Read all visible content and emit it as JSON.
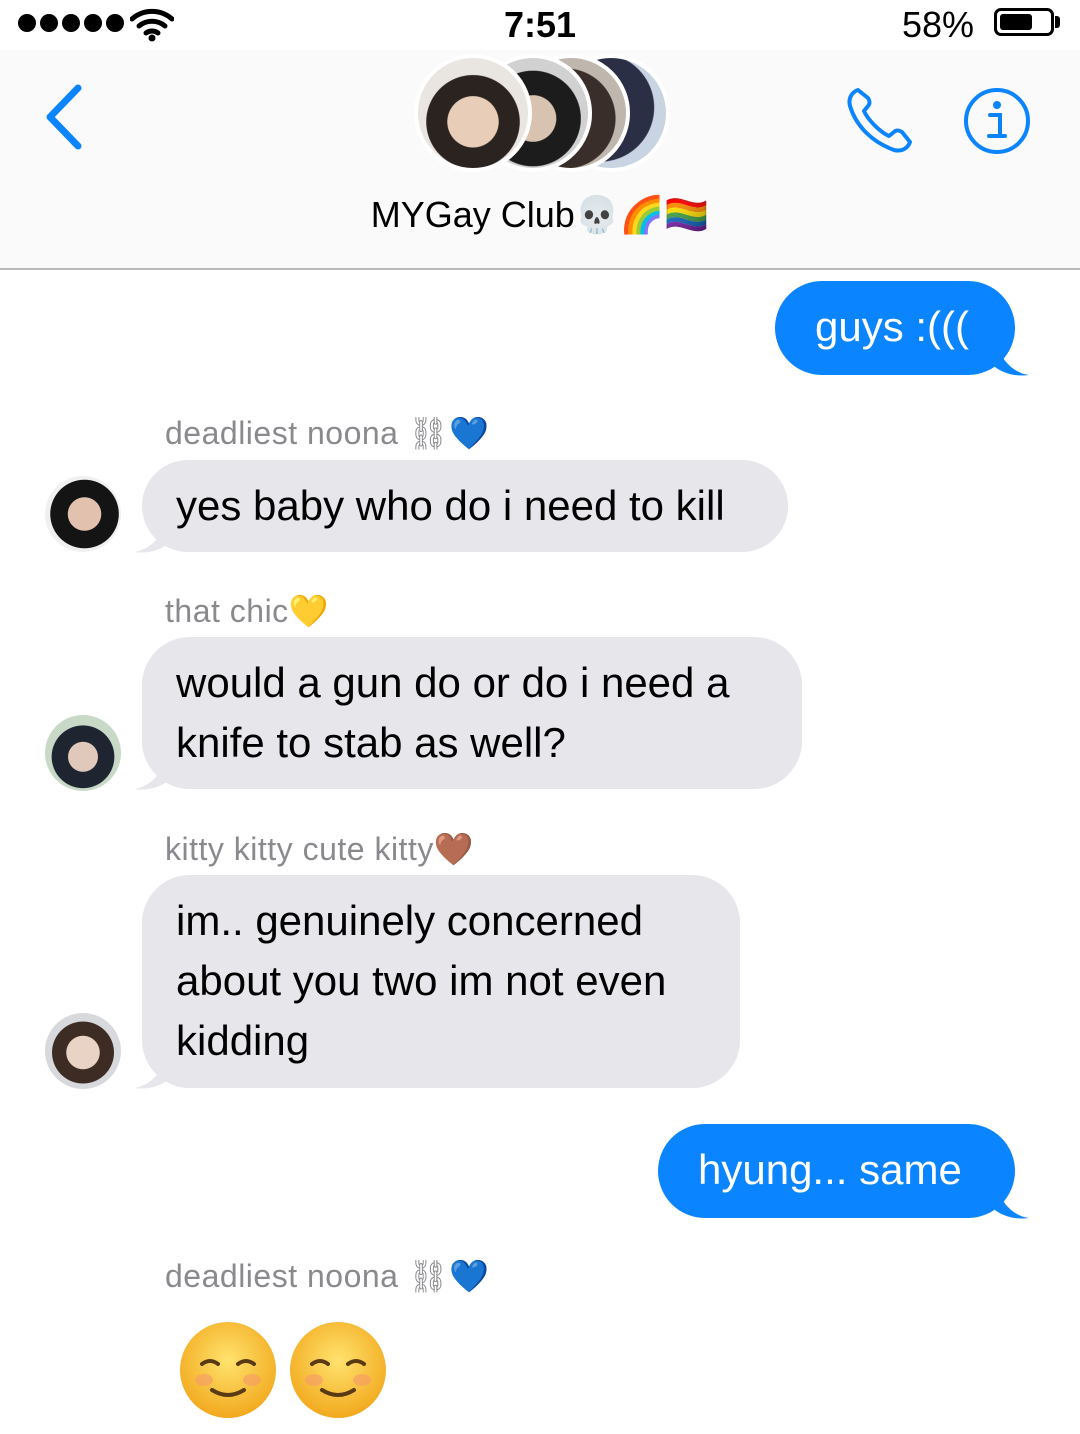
{
  "status_bar": {
    "time": "7:51",
    "battery_percent": "58%",
    "battery_level": 0.58,
    "signal_bars": 5
  },
  "header": {
    "title": "MYGay Club💀🌈🏳️‍🌈",
    "back_icon": "chevron-left-icon",
    "call_icon": "phone-icon",
    "info_icon": "info-icon",
    "accent_color": "#0b84ff"
  },
  "messages": [
    {
      "direction": "outgoing",
      "text": "guys :((("
    },
    {
      "direction": "incoming",
      "sender": "deadliest noona ⛓💙",
      "text": "yes baby who do i need to kill"
    },
    {
      "direction": "incoming",
      "sender": "that chic💛",
      "text": "would a gun do or do i need a knife to stab as well?"
    },
    {
      "direction": "incoming",
      "sender": "kitty kitty cute kitty🤎",
      "text": "im.. genuinely concerned about you two im not even kidding"
    },
    {
      "direction": "outgoing",
      "text": "hyung... same"
    },
    {
      "direction": "incoming",
      "sender": "deadliest noona ⛓💙",
      "text": "☺️☺️"
    }
  ],
  "colors": {
    "outgoing_bubble": "#0b84ff",
    "incoming_bubble": "#e6e6eb",
    "sender_label": "#8a8a8e"
  }
}
